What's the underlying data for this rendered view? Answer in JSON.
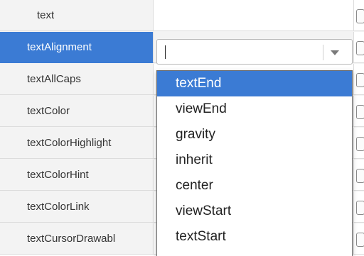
{
  "rows": [
    {
      "name": "text"
    },
    {
      "name": "textAlignment"
    },
    {
      "name": "textAllCaps"
    },
    {
      "name": "textColor"
    },
    {
      "name": "textColorHighlight"
    },
    {
      "name": "textColorHint"
    },
    {
      "name": "textColorLink"
    },
    {
      "name": "textCursorDrawabl"
    }
  ],
  "selected_row": "textAlignment",
  "combo": {
    "value": ""
  },
  "dropdown": {
    "highlighted": "textEnd",
    "options": [
      "textEnd",
      "viewEnd",
      "gravity",
      "inherit",
      "center",
      "viewStart",
      "textStart"
    ]
  },
  "colors": {
    "selection": "#3b7bd4",
    "panel": "#f3f3f3"
  }
}
